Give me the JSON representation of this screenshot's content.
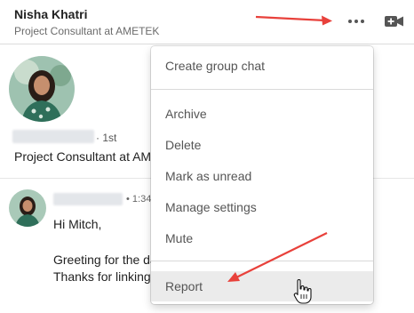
{
  "header": {
    "name": "Nisha Khatri",
    "headline": "Project Consultant at AMETEK"
  },
  "profile": {
    "degree": "· 1st",
    "headline": "Project Consultant at AMETEK"
  },
  "message": {
    "time": "• 1:34",
    "lines": [
      "Hi Mitch,",
      "Greeting for the day",
      "Thanks for linking"
    ]
  },
  "menu": {
    "items": [
      "Create group chat",
      "Archive",
      "Delete",
      "Mark as unread",
      "Manage settings",
      "Mute",
      "Report"
    ],
    "hovered": "Report"
  },
  "colors": {
    "annotation_arrow": "#e8413b",
    "menu_hover": "#ebebeb",
    "divider": "#dcdcdc"
  },
  "icons": [
    "more-icon",
    "video-call-icon",
    "hand-cursor-icon"
  ]
}
